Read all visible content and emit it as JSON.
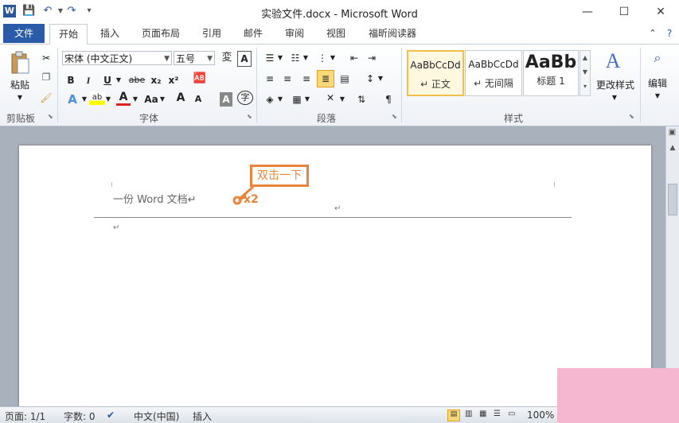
{
  "window": {
    "title": "实验文件.docx - Microsoft Word",
    "app_icon": "W",
    "minimize_label": "—",
    "maximize_label": "☐",
    "close_label": "✕"
  },
  "qat": {
    "save_icon": "💾",
    "undo_icon": "↶",
    "redo_icon": "↷"
  },
  "tabs": [
    "文件",
    "开始",
    "插入",
    "页面布局",
    "引用",
    "邮件",
    "审阅",
    "视图",
    "福昕阅读器"
  ],
  "ribbon": {
    "clipboard": {
      "paste_label": "粘贴",
      "group_label": "剪贴板"
    },
    "font": {
      "font_name": "宋体 (中文正文)",
      "font_size": "五号",
      "bold": "B",
      "italic": "I",
      "underline": "U",
      "strike": "abe",
      "subscript": "x₂",
      "superscript": "x²",
      "grow": "A",
      "shrink": "A",
      "case": "Aa",
      "group_label": "字体"
    },
    "paragraph": {
      "group_label": "段落"
    },
    "styles": {
      "items": [
        {
          "sample": "AaBbCcDd",
          "name": "↵ 正文"
        },
        {
          "sample": "AaBbCcDd",
          "name": "↵ 无间隔"
        },
        {
          "sample": "AaBb",
          "name": "标题 1"
        }
      ],
      "change_label": "更改样式",
      "group_label": "样式"
    },
    "editing": {
      "label": "编辑"
    }
  },
  "document": {
    "header_text": "一份 Word 文档↵",
    "header_mark": "↵",
    "body_mark": "↵",
    "callout": "双击一下",
    "click_hint": "x2"
  },
  "status": {
    "page": "页面: 1/1",
    "words": "字数: 0",
    "language": "中文(中国)",
    "mode": "插入",
    "zoom": "100%"
  },
  "colors": {
    "file_tab": "#2a5ba8",
    "callout": "#e8843b",
    "pink_block": "#f5b6cf"
  }
}
